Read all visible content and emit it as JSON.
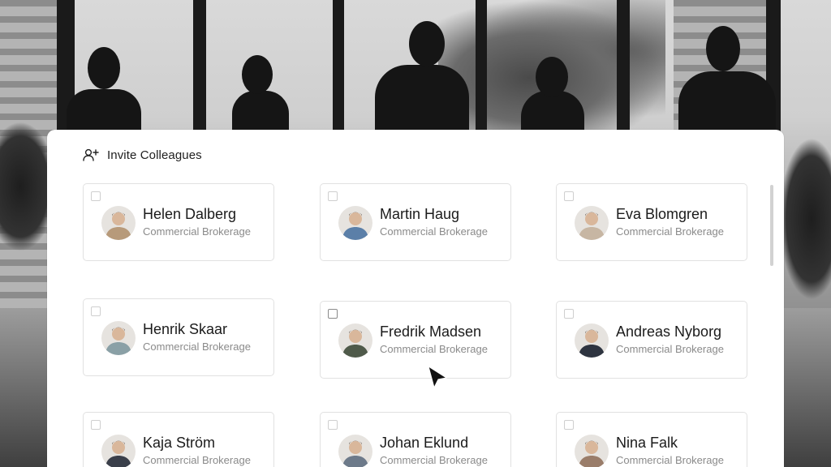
{
  "panel": {
    "title": "Invite Colleagues",
    "icon": "add-user-icon"
  },
  "colleagues": [
    {
      "name": "Helen Dalberg",
      "role": "Commercial Brokerage",
      "avatar_color": "#b79a7a",
      "selected": false
    },
    {
      "name": "Martin Haug",
      "role": "Commercial Brokerage",
      "avatar_color": "#5b7fa8",
      "selected": false
    },
    {
      "name": "Eva Blomgren",
      "role": "Commercial Brokerage",
      "avatar_color": "#c7b6a3",
      "selected": false
    },
    {
      "name": "Henrik Skaar",
      "role": "Commercial Brokerage",
      "avatar_color": "#8aa0a6",
      "selected": false
    },
    {
      "name": "Fredrik Madsen",
      "role": "Commercial Brokerage",
      "avatar_color": "#4f5a4a",
      "selected": false
    },
    {
      "name": "Andreas Nyborg",
      "role": "Commercial Brokerage",
      "avatar_color": "#2e3440",
      "selected": false
    },
    {
      "name": "Kaja Ström",
      "role": "Commercial Brokerage",
      "avatar_color": "#3a3f4a",
      "selected": false
    },
    {
      "name": "Johan Eklund",
      "role": "Commercial Brokerage",
      "avatar_color": "#6d7a8a",
      "selected": false
    },
    {
      "name": "Nina Falk",
      "role": "Commercial Brokerage",
      "avatar_color": "#9a7d6a",
      "selected": false
    }
  ],
  "colors": {
    "panel_bg": "#ffffff",
    "card_border": "#e1e1e1",
    "name_text": "#1b1b1b",
    "role_text": "#8a8a8a"
  }
}
